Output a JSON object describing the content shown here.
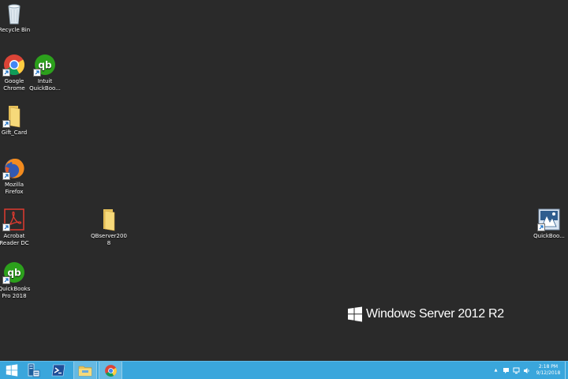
{
  "desktop_icons": {
    "recycle_bin": "Recycle Bin",
    "google_chrome": "Google Chrome",
    "intuit_quickbooks": "Intuit QuickBoo...",
    "gift_card": "Gift_Card",
    "mozilla_firefox": "Mozilla Firefox",
    "acrobat_reader": "Acrobat Reader DC",
    "quickbooks_pro": "QuickBooks Pro 2018",
    "qbserver": "QBserver2008",
    "quickbooks_right": "QuickBoo..."
  },
  "watermark": {
    "text": "Windows Server 2012 R2"
  },
  "taskbar": {
    "buttons": [
      "start-icon",
      "server-manager-icon",
      "powershell-icon",
      "file-explorer-icon",
      "chrome-icon"
    ],
    "tray": {
      "arrow": "▲",
      "time": "2:18 PM",
      "date": "9/12/2018"
    }
  },
  "colors": {
    "desktop": "#2a2a2a",
    "taskbar": "#3aa6dc",
    "quickbooks_green": "#2ca01c"
  }
}
